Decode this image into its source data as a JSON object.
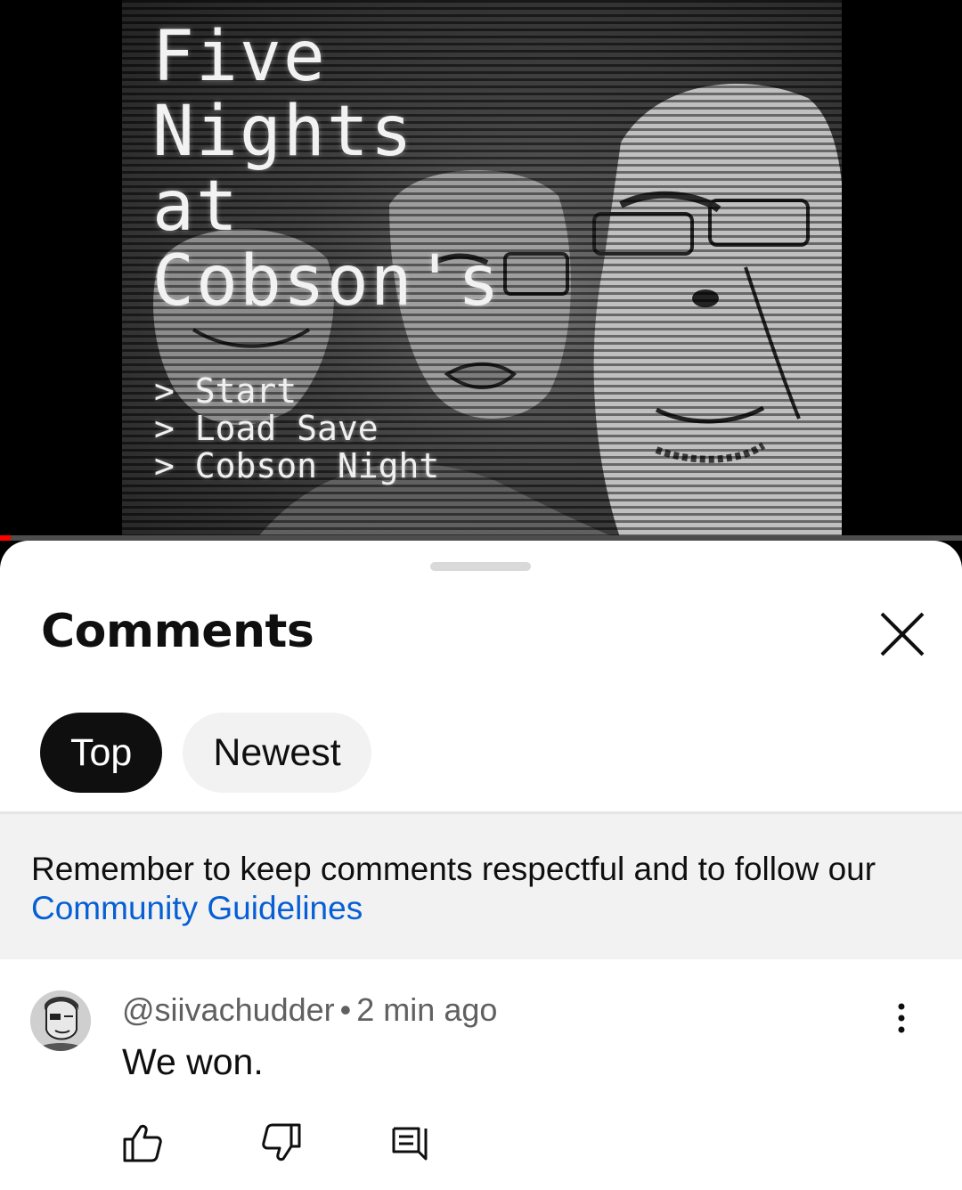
{
  "video": {
    "title_lines": [
      "Five",
      "Nights",
      "at",
      "Cobson's"
    ],
    "menu_items": [
      "> Start",
      "> Load Save",
      "> Cobson Night"
    ]
  },
  "comments_panel": {
    "title": "Comments",
    "close_icon": "close-icon",
    "filters": [
      {
        "label": "Top",
        "selected": true
      },
      {
        "label": "Newest",
        "selected": false
      }
    ],
    "notice": {
      "text": "Remember to keep comments respectful and to follow our ",
      "link_text": "Community Guidelines",
      "link_color": "#065fd4"
    },
    "comments": [
      {
        "author": "@siivachudder",
        "separator": "•",
        "time": "2 min ago",
        "text": "We won.",
        "actions": [
          "like-icon",
          "dislike-icon",
          "reply-icon"
        ],
        "menu_icon": "more-vert-icon"
      }
    ]
  },
  "colors": {
    "progress_red": "#ff0000",
    "chip_active_bg": "#0f0f0f",
    "chip_inactive_bg": "#f2f2f2",
    "notice_bg": "#f2f2f2"
  }
}
